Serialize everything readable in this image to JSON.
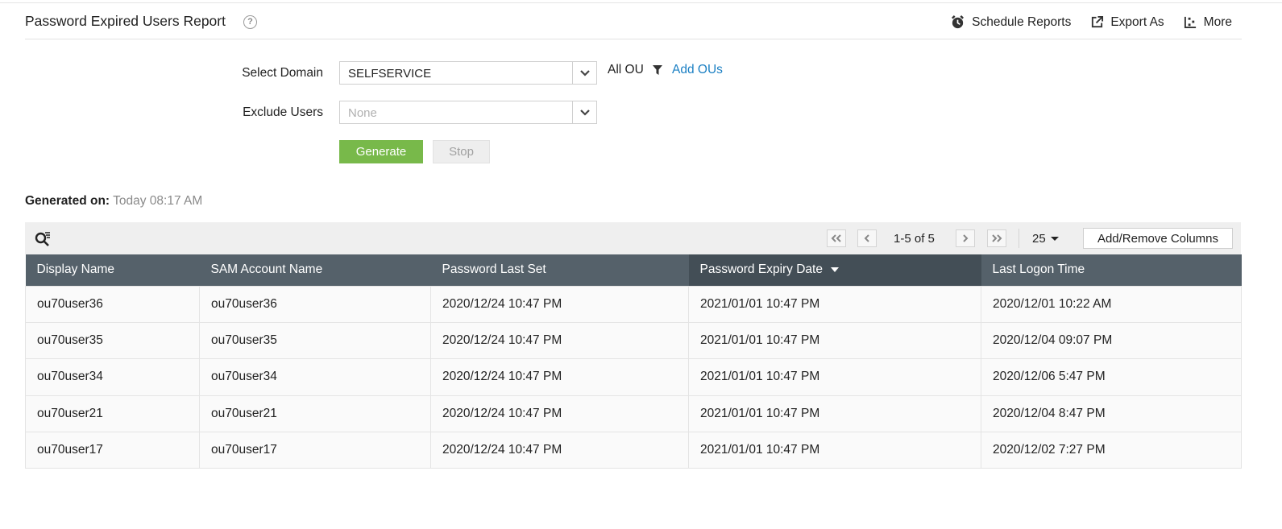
{
  "header": {
    "title": "Password Expired Users Report",
    "help_symbol": "?",
    "actions": {
      "schedule": "Schedule Reports",
      "export": "Export As",
      "more": "More"
    }
  },
  "form": {
    "domain_label": "Select Domain",
    "domain_value": "SELFSERVICE",
    "ou_text": "All OU",
    "add_ous": "Add OUs",
    "exclude_label": "Exclude Users",
    "exclude_placeholder": "None",
    "generate_label": "Generate",
    "stop_label": "Stop"
  },
  "generated": {
    "label": "Generated on:",
    "value": "Today 08:17 AM"
  },
  "grid": {
    "range_text": "1-5 of 5",
    "page_size": "25",
    "add_remove_label": "Add/Remove Columns",
    "columns": [
      "Display Name",
      "SAM Account Name",
      "Password Last Set",
      "Password Expiry Date",
      "Last Logon Time"
    ],
    "sorted_column": 3,
    "rows": [
      [
        "ou70user36",
        "ou70user36",
        "2020/12/24 10:47 PM",
        "2021/01/01 10:47 PM",
        "2020/12/01 10:22 AM"
      ],
      [
        "ou70user35",
        "ou70user35",
        "2020/12/24 10:47 PM",
        "2021/01/01 10:47 PM",
        "2020/12/04 09:07 PM"
      ],
      [
        "ou70user34",
        "ou70user34",
        "2020/12/24 10:47 PM",
        "2021/01/01 10:47 PM",
        "2020/12/06 5:47 PM"
      ],
      [
        "ou70user21",
        "ou70user21",
        "2020/12/24 10:47 PM",
        "2021/01/01 10:47 PM",
        "2020/12/04 8:47 PM"
      ],
      [
        "ou70user17",
        "ou70user17",
        "2020/12/24 10:47 PM",
        "2021/01/01 10:47 PM",
        "2020/12/02 7:27 PM"
      ]
    ]
  },
  "colors": {
    "accent_green": "#78b94a",
    "link_blue": "#1a7fc3",
    "table_header": "#55616a",
    "table_header_sorted": "#434e56"
  },
  "icons": [
    "help-icon",
    "alarm-clock-icon",
    "export-icon",
    "more-icon",
    "filter-icon",
    "chevron-down-icon",
    "search-list-icon",
    "first-page-icon",
    "prev-page-icon",
    "next-page-icon",
    "last-page-icon",
    "sort-desc-icon"
  ]
}
